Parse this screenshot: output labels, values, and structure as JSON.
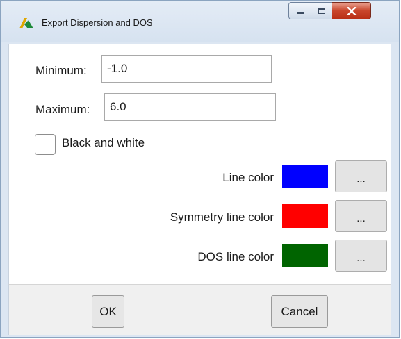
{
  "window": {
    "title": "Export Dispersion and DOS",
    "controls": {
      "minimize_icon": "minimize-icon",
      "maximize_icon": "maximize-icon",
      "close_icon": "close-icon"
    }
  },
  "form": {
    "minimum_label": "Minimum:",
    "minimum_value": "-1.0",
    "maximum_label": "Maximum:",
    "maximum_value": "6.0",
    "bw_label": "Black and white",
    "bw_checked": false
  },
  "colors": [
    {
      "label": "Line color",
      "color": "#0000ff",
      "button": "..."
    },
    {
      "label": "Symmetry line color",
      "color": "#ff0000",
      "button": "..."
    },
    {
      "label": "DOS line color",
      "color": "#006400",
      "button": "..."
    }
  ],
  "footer": {
    "ok_label": "OK",
    "cancel_label": "Cancel"
  }
}
